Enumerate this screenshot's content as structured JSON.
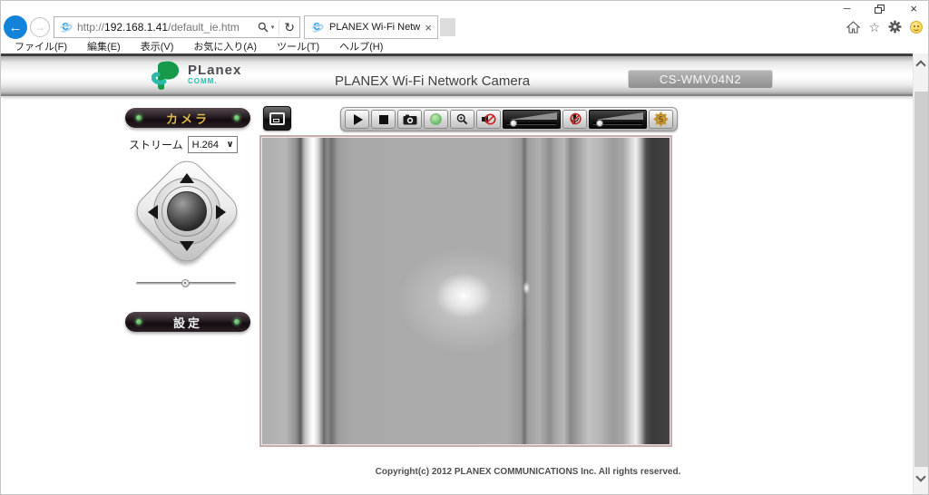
{
  "window": {
    "controls": {
      "minimize": "─",
      "close": "×"
    }
  },
  "browser": {
    "back": "←",
    "forward": "→",
    "address": {
      "prefix": "http://",
      "domain": "192.168.1.41",
      "path": "/default_ie.htm",
      "dropdown": "▾",
      "refresh": "↻"
    },
    "tab": {
      "title": "PLANEX Wi-Fi Network Ca...",
      "close": "×"
    },
    "favorites_star": "☆",
    "menu": [
      "ファイル(F)",
      "編集(E)",
      "表示(V)",
      "お気に入り(A)",
      "ツール(T)",
      "ヘルプ(H)"
    ]
  },
  "page": {
    "logo": {
      "wordmark": "PLanex",
      "sub": "COMM."
    },
    "header_title": "PLANEX Wi-Fi Network Camera",
    "model": "CS-WMV04N2",
    "camera_button": "カメラ",
    "stream": {
      "label": "ストリーム",
      "value": "H.264",
      "caret": "∨"
    },
    "settings_button": "設定",
    "footer": "Copyright(c) 2012 PLANEX COMMUNICATIONS Inc. All rights reserved."
  },
  "toolbar_icons": [
    "fullscreen",
    "play",
    "stop",
    "snapshot",
    "record",
    "zoom-in",
    "mute-speaker",
    "volume-slider",
    "mute-mic",
    "mic-slider",
    "settings-gear"
  ],
  "colors": {
    "back_button_blue": "#1283d8",
    "record_green": "#7cc67c",
    "button_gold_text": "#dcb948",
    "led_green": "#3c9a46",
    "brand_green": "#169a4a",
    "brand_teal": "#2fb9ad",
    "gear_gold": "#d2a53c",
    "mute_red": "#cc2020",
    "badge_gray": "#9e9e9e",
    "dark_button": "#2c2329"
  }
}
